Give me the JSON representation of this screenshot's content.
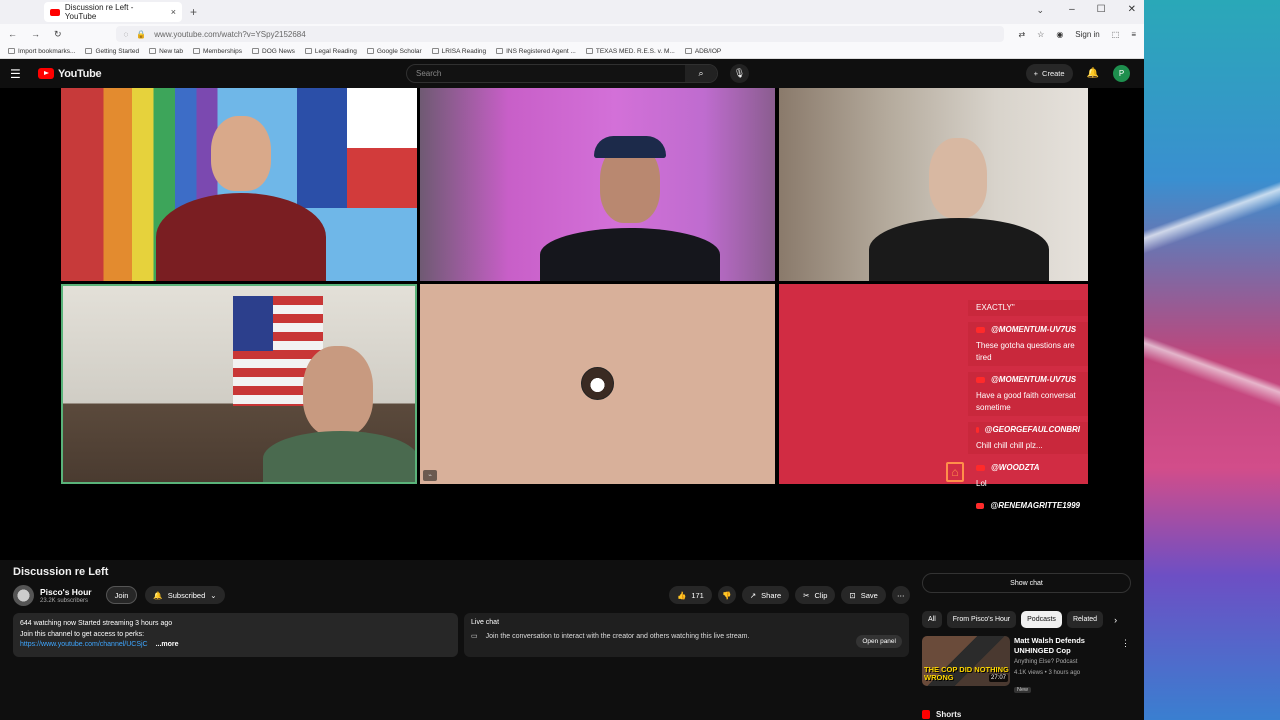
{
  "browser": {
    "tab_title": "Discussion re Left - YouTube",
    "url": "www.youtube.com/watch?v=YSpy2152684",
    "sign_in": "Sign in",
    "bookmarks": [
      "Import bookmarks...",
      "Getting Started",
      "New tab",
      "Memberships",
      "DOG News",
      "Legal Reading",
      "Google Scholar",
      "LRISA Reading",
      "INS Registered Agent ...",
      "TEXAS MED. R.E.S. v. M...",
      "ADB/IOP"
    ]
  },
  "header": {
    "logo_text": "YouTube",
    "search_placeholder": "Search",
    "create_label": "Create",
    "avatar_letter": "P"
  },
  "chat_overlay": {
    "messages": [
      {
        "user": "",
        "text": "EXACTLY\""
      },
      {
        "user": "@MOMENTUM-UV7US",
        "text": "These gotcha questions are tired"
      },
      {
        "user": "@MOMENTUM-UV7US",
        "text": "Have a good faith conversat sometime"
      },
      {
        "user": "@GEORGEFAULCONBRI",
        "text": "Chill chill chill plz..."
      },
      {
        "user": "@WOODZTA",
        "text": "Lol"
      },
      {
        "user": "@RENEMAGRITTE1999",
        "text": ""
      }
    ]
  },
  "video": {
    "title": "Discussion re Left",
    "channel_name": "Pisco's Hour",
    "subscribers": "23.2K subscribers",
    "join_label": "Join",
    "subscribed_label": "Subscribed",
    "likes": "171",
    "share_label": "Share",
    "clip_label": "Clip",
    "save_label": "Save"
  },
  "description": {
    "line1": "644 watching now  Started streaming 3 hours ago",
    "line2": "Join this channel to get access to perks:",
    "link": "https://www.youtube.com/channel/UCSjC",
    "more": "...more"
  },
  "live_chat": {
    "title": "Live chat",
    "text": "Join the conversation to interact with the creator and others watching this live stream.",
    "open_panel": "Open panel"
  },
  "sidebar": {
    "show_chat": "Show chat",
    "filters": [
      "All",
      "From Pisco's Hour",
      "Podcasts",
      "Related"
    ],
    "active_filter": "Podcasts",
    "rec": {
      "title": "Matt Walsh Defends UNHINGED Cop",
      "channel": "Anything Else? Podcast",
      "meta": "4.1K views • 3 hours ago",
      "badge": "New",
      "thumb_text": "THE COP DID NOTHING WRONG",
      "duration": "27:07"
    },
    "shorts_label": "Shorts"
  }
}
